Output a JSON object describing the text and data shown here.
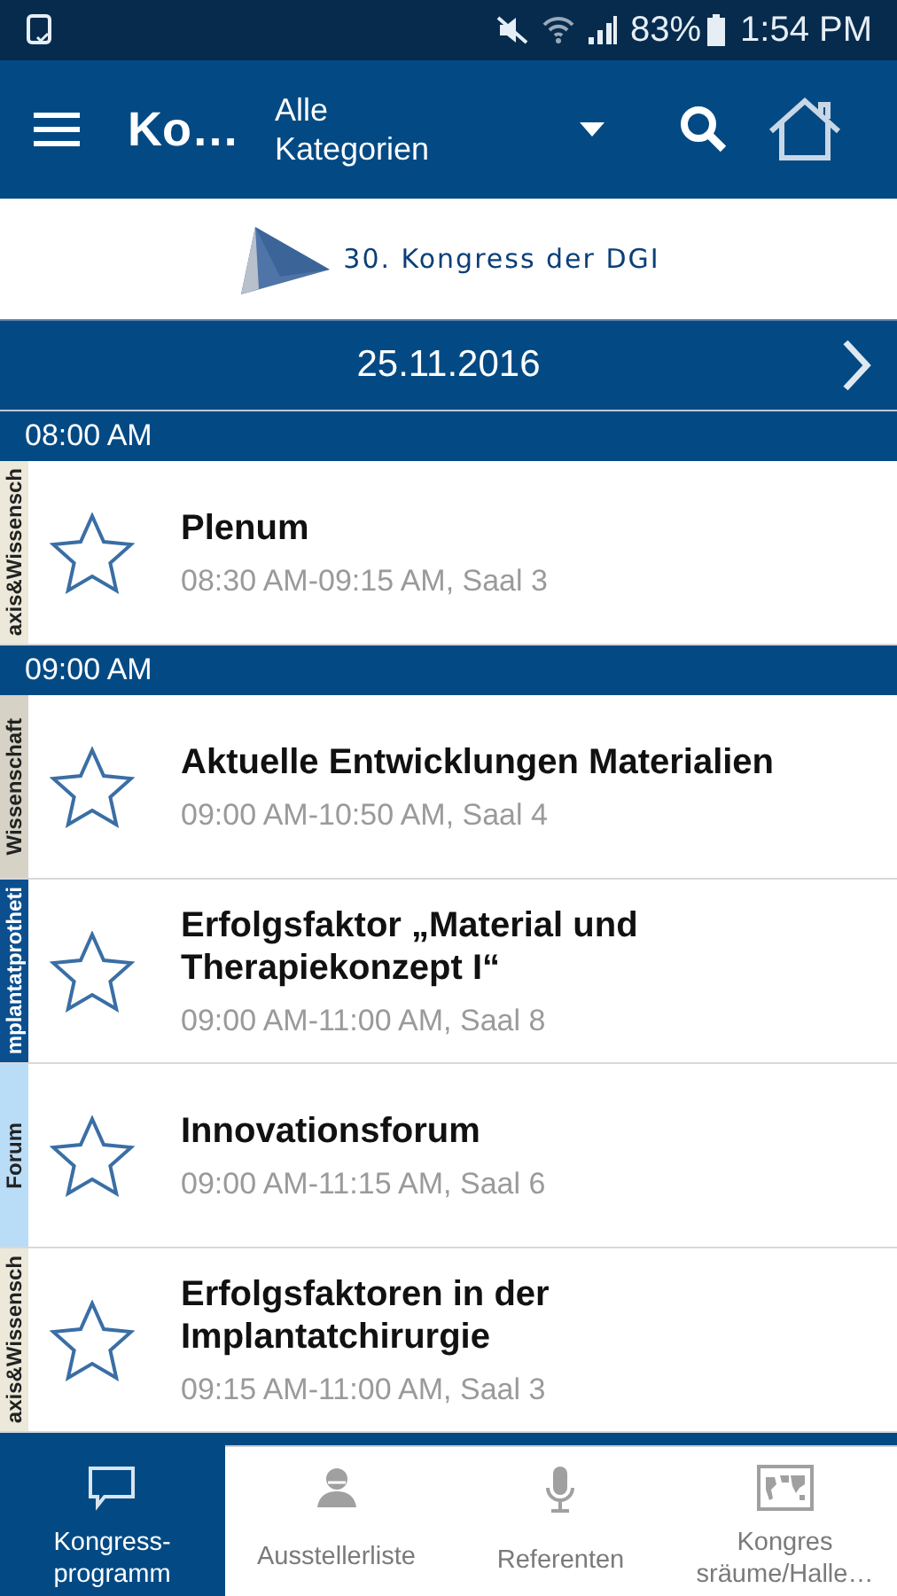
{
  "status_bar": {
    "battery": "83%",
    "time": "1:54 PM"
  },
  "app_bar": {
    "title": "Ko…",
    "category": "Alle Kategorien"
  },
  "banner": {
    "logo_text": "30. Kongress der DGI"
  },
  "date_bar": {
    "date": "25.11.2016"
  },
  "groups": [
    {
      "time": "08:00 AM",
      "sessions": [
        {
          "title": "Plenum",
          "details": "08:30 AM-09:15 AM, Saal 3",
          "tag": "axis&Wissensch",
          "color": "#ece8da",
          "starred": false
        }
      ]
    },
    {
      "time": "09:00 AM",
      "sessions": [
        {
          "title": "Aktuelle Entwicklungen Materialien",
          "details": "09:00 AM-10:50 AM, Saal 4",
          "tag": "Wissenschaft",
          "color": "#d6d2c6",
          "starred": false
        },
        {
          "title": "Erfolgsfaktor „Material und Therapiekonzept I“",
          "details": "09:00 AM-11:00 AM, Saal 8",
          "tag": "mplantatprotheti",
          "color": "#0b4f8f",
          "starred": false
        },
        {
          "title": "Innovationsforum",
          "details": "09:00 AM-11:15 AM, Saal 6",
          "tag": "Forum",
          "color": "#b9dcf7",
          "starred": false
        },
        {
          "title": "Erfolgsfaktoren in der Implantatchirurgie",
          "details": "09:15 AM-11:00 AM, Saal 3",
          "tag": "axis&Wissensch",
          "color": "#ece8da",
          "starred": false
        }
      ]
    }
  ],
  "bottom_nav": [
    {
      "label": "Kongress-programm",
      "kind": "chat",
      "selected": true
    },
    {
      "label": "Ausstellerliste",
      "kind": "person",
      "selected": false
    },
    {
      "label": "Referenten",
      "kind": "mic",
      "selected": false
    },
    {
      "label": "Kongres sräume/Halle…",
      "kind": "map",
      "selected": false
    }
  ]
}
